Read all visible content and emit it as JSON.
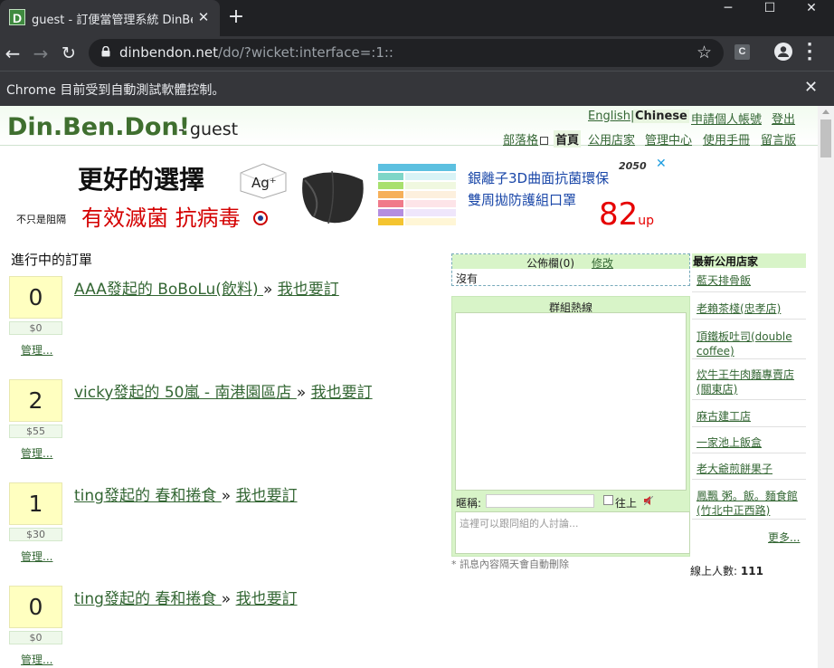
{
  "browser": {
    "tab_title": "guest - 訂便當管理系統 DinBen",
    "favicon_letter": "D",
    "url_host": "dinbendon.net",
    "url_path": "/do/?wicket:interface=:1::",
    "infobar_text": "Chrome 目前受到自動測試軟體控制。"
  },
  "header": {
    "logo": "Din.Ben.Don!",
    "user": "- guest",
    "top_links": [
      "English",
      "|",
      "Chinese",
      "申請個人帳號",
      "登出"
    ],
    "nav_links": [
      "部落格",
      "首頁",
      "公用店家",
      "管理中心",
      "使用手冊",
      "留言版"
    ]
  },
  "ad": {
    "headline": "更好的選擇",
    "tag": "不只是阻隔",
    "big_text": "有效滅菌  抗病毒",
    "ag_label": "Ag⁺",
    "text_line1": "銀離子3D曲面抗菌環保",
    "text_line2": "雙周拋防護組口罩",
    "big_number": "82",
    "big_number_suffix": "up",
    "brand": "2050",
    "close": "✕"
  },
  "orders": {
    "title": "進行中的訂單",
    "items": [
      {
        "count": "0",
        "amount": "$0",
        "manage": "管理...",
        "text": "AAA發起的 BoBoLu(飲料) ",
        "sep": "»",
        "join": "我也要訂"
      },
      {
        "count": "2",
        "amount": "$55",
        "manage": "管理...",
        "text": "vicky發起的 50嵐 - 南港園區店 ",
        "sep": "»",
        "join": "我也要訂"
      },
      {
        "count": "1",
        "amount": "$30",
        "manage": "管理...",
        "text": "ting發起的 春和捲食 ",
        "sep": "»",
        "join": "我也要訂"
      },
      {
        "count": "0",
        "amount": "$0",
        "manage": "管理...",
        "text": "ting發起的 春和捲食 ",
        "sep": "»",
        "join": "我也要訂"
      }
    ]
  },
  "notice": {
    "title": "公佈欄(0)",
    "edit": "修改",
    "body": "沒有"
  },
  "chat": {
    "title": "群組熱線",
    "nick_label": "暱稱:",
    "top_label": "往上",
    "placeholder": "這裡可以跟同組的人討論...",
    "note": "* 訊息內容隔天會自動刪除"
  },
  "stores": {
    "title": "最新公用店家",
    "items": [
      "藍天排骨飯",
      "老賴茶棧(忠孝店)",
      "頂鐵板吐司(double coffee)",
      "炊牛王牛肉麵專賣店(關東店)",
      "麻古建工店",
      "一家池上飯盒",
      "老大爺煎餅果子",
      "鳳飄 粥。飯。麵食館(竹北中正西路)"
    ],
    "more": "更多..."
  },
  "online": {
    "label": "線上人數:",
    "count": "111"
  },
  "colors": {
    "accent": "#336633",
    "panel": "#d8f4c8",
    "count_bg": "#ffffc0",
    "chrome_dark": "#202124",
    "chrome_mid": "#35363a"
  }
}
